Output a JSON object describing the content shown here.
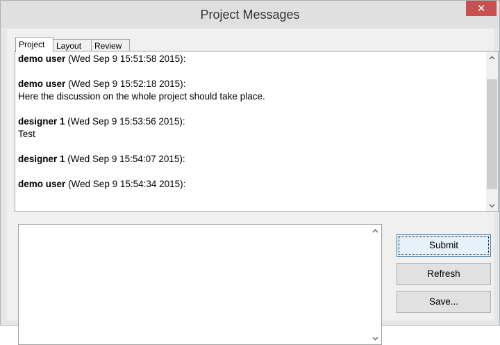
{
  "window": {
    "title": "Project Messages",
    "close_glyph": "✕"
  },
  "tabs": [
    {
      "label": "Project",
      "active": true
    },
    {
      "label": "Layout",
      "active": false
    },
    {
      "label": "Review",
      "active": false
    }
  ],
  "messages": [
    {
      "author": "demo user",
      "timestamp": "(Wed Sep 9 15:51:58 2015):",
      "body": ""
    },
    {
      "author": "demo user",
      "timestamp": "(Wed Sep 9 15:52:18 2015):",
      "body": "Here the discussion on the whole project should take place."
    },
    {
      "author": "designer 1",
      "timestamp": "(Wed Sep 9 15:53:56 2015):",
      "body": "Test"
    },
    {
      "author": "designer 1",
      "timestamp": "(Wed Sep 9 15:54:07 2015):",
      "body": ""
    },
    {
      "author": "demo user",
      "timestamp": "(Wed Sep 9 15:54:34 2015):",
      "body": ""
    }
  ],
  "input": {
    "value": ""
  },
  "buttons": {
    "submit": "Submit",
    "refresh": "Refresh",
    "save": "Save..."
  },
  "icons": {
    "scroll_up": "chevron-up-icon",
    "scroll_down": "chevron-down-icon",
    "close": "close-icon"
  },
  "colors": {
    "close_button": "#c75050",
    "default_button_border": "#3c7fb1"
  }
}
